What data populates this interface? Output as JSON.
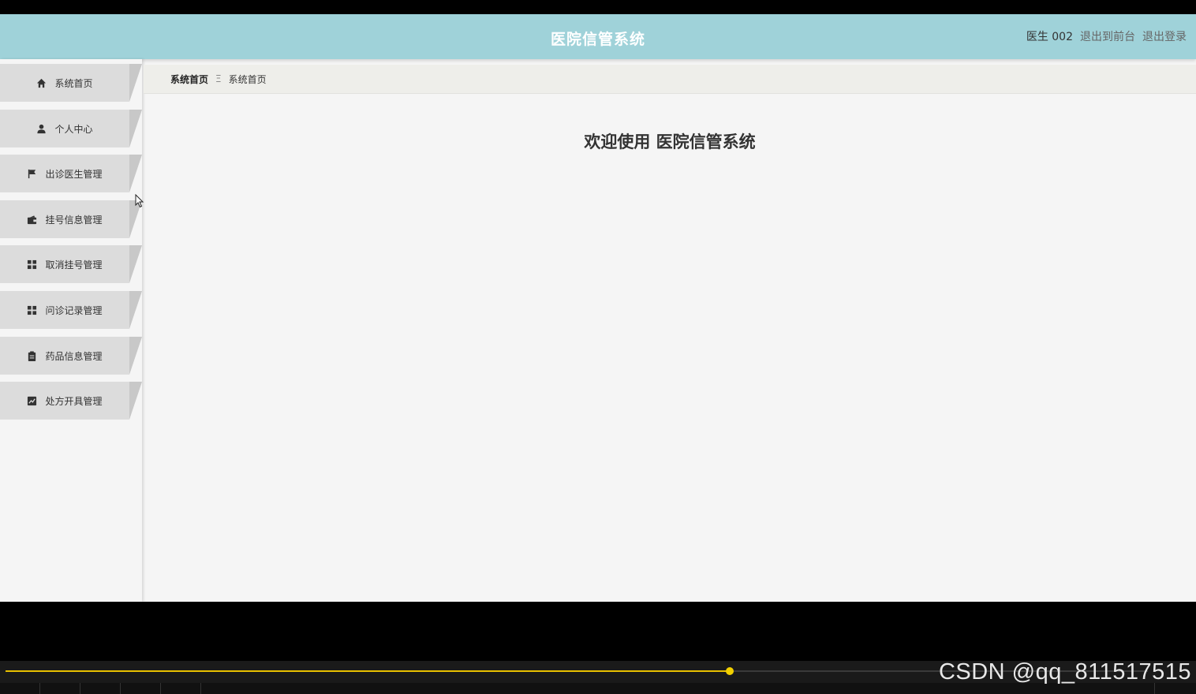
{
  "header": {
    "title": "医院信管系统",
    "user": "医生 002",
    "to_front_label": "退出到前台",
    "logout_label": "退出登录"
  },
  "sidebar": {
    "items": [
      {
        "label": "系统首页",
        "icon": "home-icon"
      },
      {
        "label": "个人中心",
        "icon": "person-icon"
      },
      {
        "label": "出诊医生管理",
        "icon": "flag-icon"
      },
      {
        "label": "挂号信息管理",
        "icon": "wallet-icon"
      },
      {
        "label": "取消挂号管理",
        "icon": "grid-icon"
      },
      {
        "label": "问诊记录管理",
        "icon": "grid-icon"
      },
      {
        "label": "药品信息管理",
        "icon": "clipboard-icon"
      },
      {
        "label": "处方开具管理",
        "icon": "chart-icon"
      }
    ]
  },
  "breadcrumb": {
    "first": "系统首页",
    "separator": "Ξ",
    "current": "系统首页"
  },
  "main": {
    "welcome": "欢迎使用 医院信管系统"
  },
  "player": {
    "progress": 0.634
  },
  "watermark": "CSDN @qq_811517515"
}
